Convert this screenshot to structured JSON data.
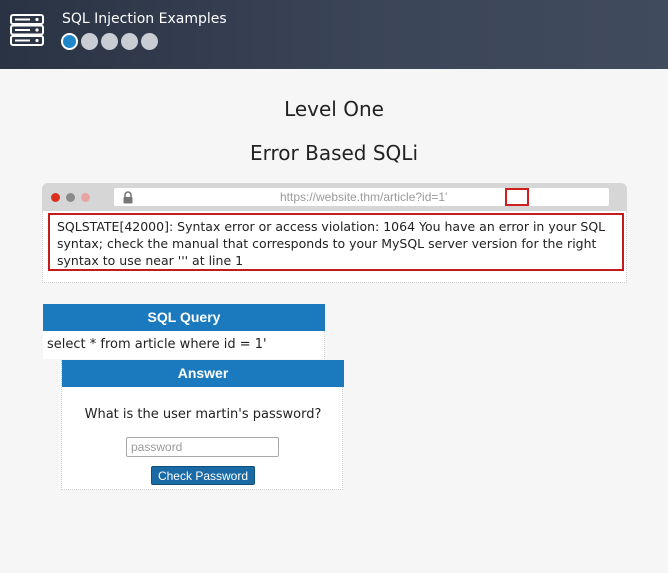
{
  "header": {
    "app_title": "SQL Injection Examples",
    "progress": {
      "total_levels": 5,
      "current_level": 1
    }
  },
  "page": {
    "level_title": "Level One",
    "section_title": "Error Based SQLi"
  },
  "browser": {
    "url": "https://website.thm/article?id=1'",
    "error_message": "SQLSTATE[42000]: Syntax error or access violation: 1064 You have an error in your SQL syntax; check the manual that corresponds to your MySQL server version for the right syntax to use near ''' at line 1"
  },
  "sql_query": {
    "heading": "SQL Query",
    "query": "select * from article where id = 1'"
  },
  "answer": {
    "heading": "Answer",
    "question": "What is the user martin's password?",
    "password_placeholder": "password",
    "password_value": "",
    "button_label": "Check Password"
  },
  "colors": {
    "header_bg": "#2a3343",
    "accent_blue": "#1a7abd",
    "highlight_red": "#c41a1a",
    "active_dot": "#1f86c8",
    "inactive_dot": "#c9cdd3"
  }
}
